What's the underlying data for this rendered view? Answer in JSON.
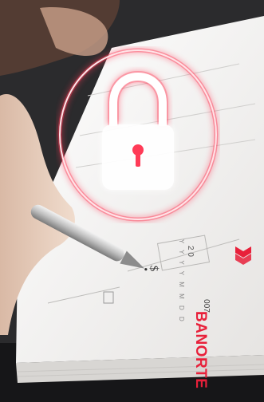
{
  "brand": {
    "name": "BANORTE",
    "color": "#e8203a"
  },
  "cheque": {
    "date_digits": "2 0",
    "date_format": "Y Y Y Y M M D D",
    "amount_sign": "$",
    "number": "007"
  },
  "icons": {
    "lock": "lock-icon",
    "pen": "pen-icon",
    "brand_mark": "banorte-logo-icon"
  },
  "colors": {
    "glow": "#ff3b57",
    "lock_fill": "#ffffff",
    "paper": "#f2f1ef"
  }
}
